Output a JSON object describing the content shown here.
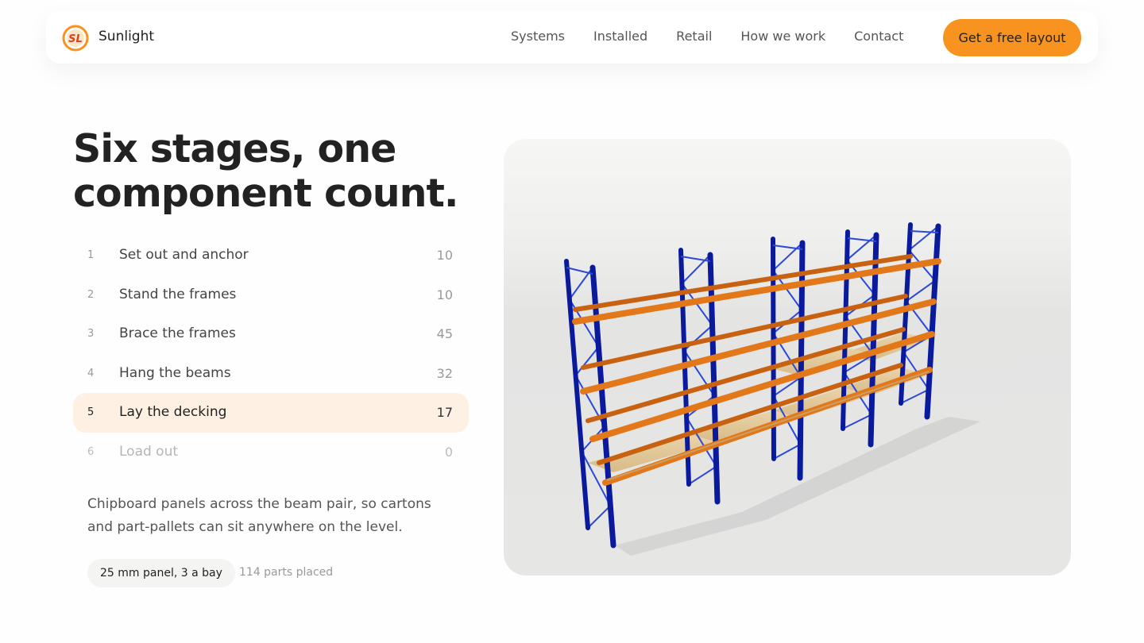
{
  "brand": {
    "name": "Sunlight",
    "logo_text": "SL"
  },
  "nav": {
    "links": [
      "Systems",
      "Installed",
      "Retail",
      "How we work",
      "Contact"
    ],
    "cta": "Get a free layout"
  },
  "hero": {
    "title_line1": "Six stages, one",
    "title_line2": "component count."
  },
  "steps": [
    {
      "num": "1",
      "label": "Set out and anchor",
      "count": "10"
    },
    {
      "num": "2",
      "label": "Stand the frames",
      "count": "10"
    },
    {
      "num": "3",
      "label": "Brace the frames",
      "count": "45"
    },
    {
      "num": "4",
      "label": "Hang the beams",
      "count": "32"
    },
    {
      "num": "5",
      "label": "Lay the decking",
      "count": "17",
      "state": "active"
    },
    {
      "num": "6",
      "label": "Load out",
      "count": "0",
      "state": "dim"
    }
  ],
  "detail": {
    "description": "Chipboard panels across the beam pair, so cartons and part-pallets can sit anywhere on the level.",
    "chip": "25 mm panel, 3 a bay",
    "parts_placed": "114 parts placed"
  },
  "colors": {
    "accent": "#f7931e",
    "active_row": "#fef1e3",
    "upright": "#0a1a9c",
    "beam": "#e2781a",
    "deck": "#dcc08e"
  },
  "icons": {
    "logo": "sunlight-logo-icon"
  }
}
